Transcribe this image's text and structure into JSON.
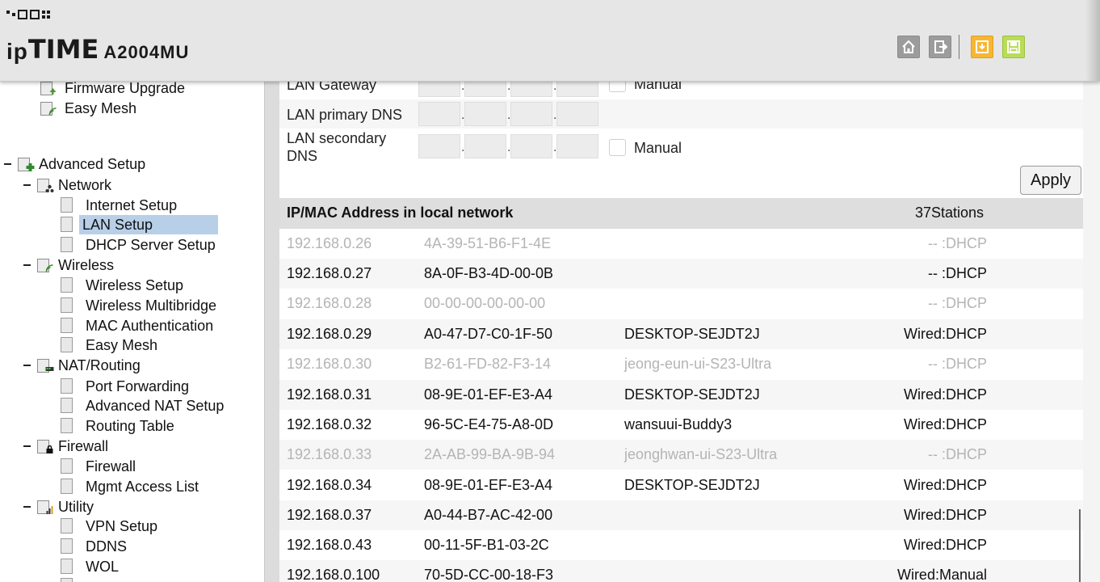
{
  "header": {
    "brand_ip": "ip",
    "brand_time": "TIME",
    "model": "A2004MU",
    "icons": [
      "home-icon",
      "logout-icon",
      "orange-save-icon",
      "green-save-icon"
    ]
  },
  "sidebar": {
    "items": [
      {
        "label": "Firmware Upgrade",
        "icon": "firmware-icon"
      },
      {
        "label": "Easy Mesh",
        "icon": "mesh-icon"
      },
      {
        "label": "Advanced Setup",
        "icon": "advanced-icon"
      },
      {
        "label": "Network",
        "icon": "network-icon"
      },
      {
        "label": "Internet Setup"
      },
      {
        "label": "LAN Setup",
        "selected": true
      },
      {
        "label": "DHCP Server Setup"
      },
      {
        "label": "Wireless",
        "icon": "wireless-icon"
      },
      {
        "label": "Wireless Setup"
      },
      {
        "label": "Wireless Multibridge"
      },
      {
        "label": "MAC Authentication"
      },
      {
        "label": "Easy Mesh"
      },
      {
        "label": "NAT/Routing",
        "icon": "nat-icon"
      },
      {
        "label": "Port Forwarding"
      },
      {
        "label": "Advanced NAT Setup"
      },
      {
        "label": "Routing Table"
      },
      {
        "label": "Firewall",
        "icon": "firewall-icon"
      },
      {
        "label": "Firewall"
      },
      {
        "label": "Mgmt Access List"
      },
      {
        "label": "Utility",
        "icon": "utility-icon"
      },
      {
        "label": "VPN Setup"
      },
      {
        "label": "DDNS"
      },
      {
        "label": "WOL"
      }
    ]
  },
  "form": {
    "lan_gateway_label": "LAN Gateway",
    "lan_gateway_manual": "Manual",
    "lan_primary_dns_label": "LAN primary DNS",
    "lan_secondary_dns_label": "LAN secondary DNS",
    "lan_secondary_dns_manual": "Manual",
    "apply_label": "Apply"
  },
  "table": {
    "title": "IP/MAC Address in local network",
    "count": "37Stations",
    "rows": [
      {
        "ip": "192.168.0.26",
        "mac": "4A-39-51-B6-F1-4E",
        "name": "",
        "type": "-- :DHCP",
        "inactive": true
      },
      {
        "ip": "192.168.0.27",
        "mac": "8A-0F-B3-4D-00-0B",
        "name": "",
        "type": "-- :DHCP",
        "inactive": false
      },
      {
        "ip": "192.168.0.28",
        "mac": "00-00-00-00-00-00",
        "name": "",
        "type": "-- :DHCP",
        "inactive": true
      },
      {
        "ip": "192.168.0.29",
        "mac": "A0-47-D7-C0-1F-50",
        "name": "DESKTOP-SEJDT2J",
        "type": "Wired:DHCP",
        "inactive": false
      },
      {
        "ip": "192.168.0.30",
        "mac": "B2-61-FD-82-F3-14",
        "name": "jeong-eun-ui-S23-Ultra",
        "type": "-- :DHCP",
        "inactive": true
      },
      {
        "ip": "192.168.0.31",
        "mac": "08-9E-01-EF-E3-A4",
        "name": "DESKTOP-SEJDT2J",
        "type": "Wired:DHCP",
        "inactive": false
      },
      {
        "ip": "192.168.0.32",
        "mac": "96-5C-E4-75-A8-0D",
        "name": "wansuui-Buddy3",
        "type": "Wired:DHCP",
        "inactive": false
      },
      {
        "ip": "192.168.0.33",
        "mac": "2A-AB-99-BA-9B-94",
        "name": "jeonghwan-ui-S23-Ultra",
        "type": "-- :DHCP",
        "inactive": true
      },
      {
        "ip": "192.168.0.34",
        "mac": "08-9E-01-EF-E3-A4",
        "name": "DESKTOP-SEJDT2J",
        "type": "Wired:DHCP",
        "inactive": false
      },
      {
        "ip": "192.168.0.37",
        "mac": "A0-44-B7-AC-42-00",
        "name": "",
        "type": "Wired:DHCP",
        "inactive": false
      },
      {
        "ip": "192.168.0.43",
        "mac": "00-11-5F-B1-03-2C",
        "name": "",
        "type": "Wired:DHCP",
        "inactive": false
      },
      {
        "ip": "192.168.0.100",
        "mac": "70-5D-CC-00-18-F3",
        "name": "",
        "type": "Wired:Manual",
        "inactive": false
      }
    ]
  }
}
